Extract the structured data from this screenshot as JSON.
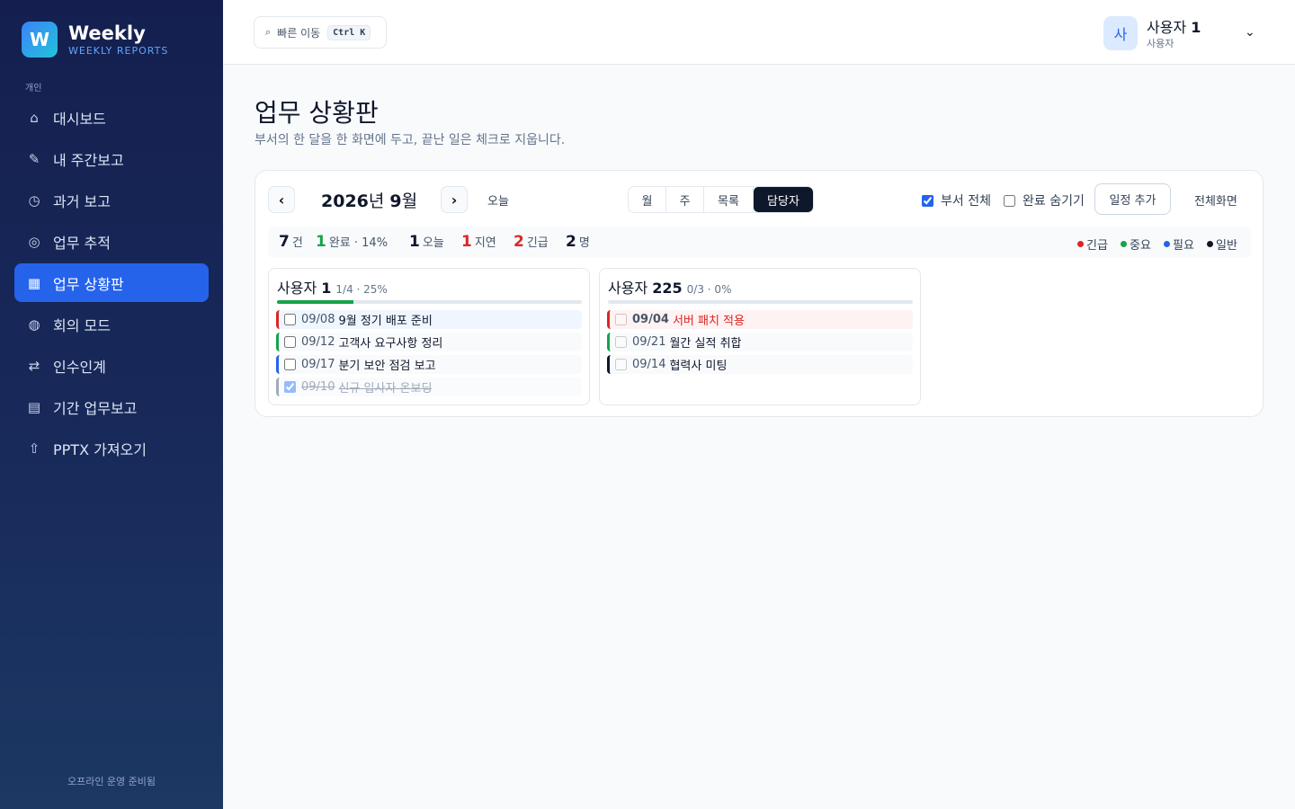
{
  "brand": {
    "logo_letter": "W",
    "name": "Weekly",
    "subtitle": "WEEKLY REPORTS"
  },
  "sidebar": {
    "section_label": "개인",
    "items": [
      {
        "label": "대시보드",
        "icon": "home-icon",
        "glyph": "⌂",
        "active": false
      },
      {
        "label": "내 주간보고",
        "icon": "pencil-icon",
        "glyph": "✎",
        "active": false
      },
      {
        "label": "과거 보고",
        "icon": "clock-icon",
        "glyph": "◷",
        "active": false
      },
      {
        "label": "업무 추적",
        "icon": "target-icon",
        "glyph": "◎",
        "active": false
      },
      {
        "label": "업무 상황판",
        "icon": "board-icon",
        "glyph": "▦",
        "active": true
      },
      {
        "label": "회의 모드",
        "icon": "globe-icon",
        "glyph": "◍",
        "active": false
      },
      {
        "label": "인수인계",
        "icon": "swap-icon",
        "glyph": "⇄",
        "active": false
      },
      {
        "label": "기간 업무보고",
        "icon": "list-icon",
        "glyph": "▤",
        "active": false
      },
      {
        "label": "PPTX 가져오기",
        "icon": "upload-icon",
        "glyph": "⇧",
        "active": false
      }
    ],
    "footer": "오프라인 운영 준비됨"
  },
  "header": {
    "quick_nav": {
      "icon": "⌕",
      "label": "빠른 이동",
      "shortcut": "Ctrl K"
    },
    "user": {
      "avatar": "사",
      "name_prefix": "사용자",
      "name_number": "1",
      "role": "사용자",
      "caret": "⌄"
    }
  },
  "page": {
    "title": "업무 상황판",
    "subtitle": "부서의 한 달을 한 화면에 두고, 끝난 일은 체크로 지웁니다."
  },
  "toolbar": {
    "prev": "‹",
    "next": "›",
    "year": "2026",
    "year_suffix": "년",
    "month": "9",
    "month_suffix": "월",
    "today": "오늘",
    "views": [
      "월",
      "주",
      "목록",
      "담당자"
    ],
    "active_view": "담당자",
    "dept_all_label": "부서 전체",
    "dept_all_checked": true,
    "hide_done_label": "완료 숨기기",
    "hide_done_checked": false,
    "add_label": "일정 추가",
    "fullscreen_label": "전체화면"
  },
  "stats": {
    "total": "7",
    "total_unit": "건",
    "done": "1",
    "done_label": "완료 · 14%",
    "today": "1",
    "today_label": "오늘",
    "overdue": "1",
    "overdue_label": "지연",
    "urgent": "2",
    "urgent_label": "긴급",
    "people": "2",
    "people_unit": "명"
  },
  "legend": [
    {
      "label": "긴급",
      "color": "#dc2626"
    },
    {
      "label": "중요",
      "color": "#16a34a"
    },
    {
      "label": "필요",
      "color": "#2563eb"
    },
    {
      "label": "일반",
      "color": "#0f172a"
    }
  ],
  "assignees": [
    {
      "name_prefix": "사용자",
      "name_number": "1",
      "meta": "1/4 · 25%",
      "progress": 0.25,
      "tasks": [
        {
          "date": "09/08",
          "title": "9월 정기 배포 준비",
          "priority_color": "#dc2626",
          "bg": "#eff6ff",
          "done": false,
          "highlight": false
        },
        {
          "date": "09/12",
          "title": "고객사 요구사항 정리",
          "priority_color": "#16a34a",
          "bg": "#f8fafc",
          "done": false,
          "highlight": false
        },
        {
          "date": "09/17",
          "title": "분기 보안 점검 보고",
          "priority_color": "#2563eb",
          "bg": "#f8fafc",
          "done": false,
          "highlight": false
        },
        {
          "date": "09/10",
          "title": "신규 입사자 온보딩",
          "priority_color": "#64748b",
          "bg": "#f8fafc",
          "done": true,
          "highlight": false
        }
      ]
    },
    {
      "name_prefix": "사용자",
      "name_number": "225",
      "meta": "0/3 · 0%",
      "progress": 0.0,
      "tasks": [
        {
          "date": "09/04",
          "title": "서버 패치 적용",
          "priority_color": "#dc2626",
          "bg": "#fef2f2",
          "done": false,
          "highlight": true
        },
        {
          "date": "09/21",
          "title": "월간 실적 취합",
          "priority_color": "#16a34a",
          "bg": "#f8fafc",
          "done": false,
          "highlight": false
        },
        {
          "date": "09/14",
          "title": "협력사 미팅",
          "priority_color": "#0f172a",
          "bg": "#f8fafc",
          "done": false,
          "highlight": false
        }
      ]
    }
  ]
}
